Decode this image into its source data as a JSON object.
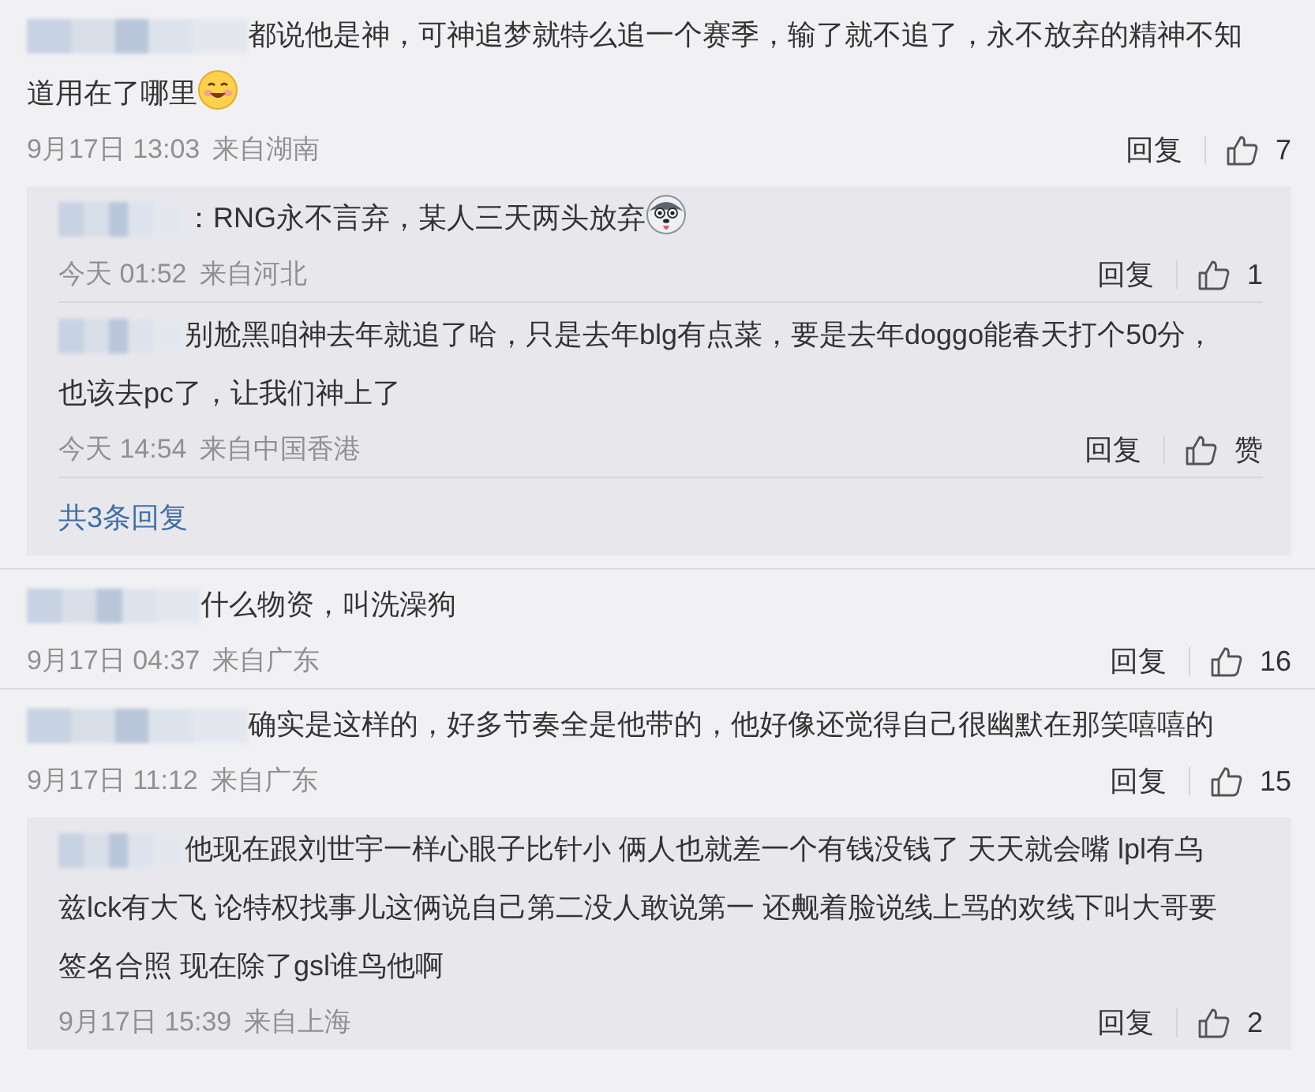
{
  "comments": [
    {
      "name_blurred": true,
      "text": "都说他是神，可神追梦就特么追一个赛季，输了就不追了，永不放弃的精神不知道用在了哪里",
      "emoji": {
        "kind": "smile"
      },
      "time": "9月17日 13:03",
      "location": "来自湖南",
      "reply_label": "回复",
      "likes": "7",
      "replies": [
        {
          "name_blurred": true,
          "text": "：RNG永不言弃，某人三天两头放弃",
          "emoji": {
            "kind": "husky"
          },
          "time": "今天 01:52",
          "location": "来自河北",
          "reply_label": "回复",
          "likes": "1"
        },
        {
          "name_blurred": true,
          "text": "别尬黑咱神去年就追了哈，只是去年blg有点菜，要是去年doggo能春天打个50分，也该去pc了，让我们神上了",
          "time": "今天 14:54",
          "location": "来自中国香港",
          "reply_label": "回复",
          "likes": "赞"
        }
      ],
      "more_replies": "共3条回复"
    },
    {
      "name_blurred": true,
      "text": "什么物资，叫洗澡狗",
      "time": "9月17日 04:37",
      "location": "来自广东",
      "reply_label": "回复",
      "likes": "16"
    },
    {
      "name_blurred": true,
      "text": "确实是这样的，好多节奏全是他带的，他好像还觉得自己很幽默在那笑嘻嘻的",
      "time": "9月17日 11:12",
      "location": "来自广东",
      "reply_label": "回复",
      "likes": "15",
      "replies": [
        {
          "name_blurred": true,
          "text": "他现在跟刘世宇一样心眼子比针小 俩人也就差一个有钱没钱了 天天就会嘴 lpl有乌兹lck有大飞 论特权找事儿这俩说自己第二没人敢说第一 还觍着脸说线上骂的欢线下叫大哥要签名合照 现在除了gsl谁鸟他啊",
          "time": "9月17日 15:39",
          "location": "来自上海",
          "reply_label": "回复",
          "likes": "2"
        }
      ]
    }
  ]
}
